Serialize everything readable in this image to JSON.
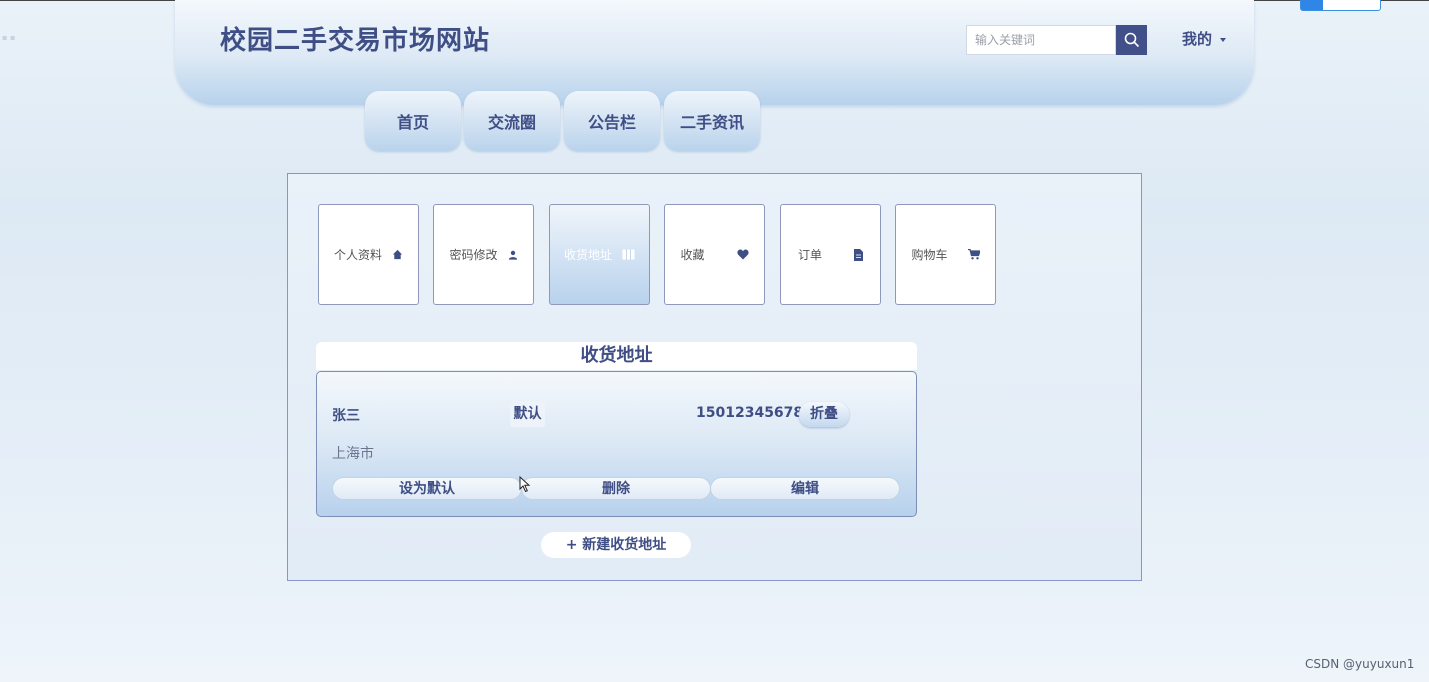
{
  "header": {
    "site_title": "校园二手交易市场网站",
    "search_placeholder": "输入关键词",
    "my_menu_label": "我的"
  },
  "nav": {
    "tabs": [
      {
        "label": "首页"
      },
      {
        "label": "交流圈"
      },
      {
        "label": "公告栏"
      },
      {
        "label": "二手资讯"
      }
    ]
  },
  "sidebar_cards": [
    {
      "label": "个人资料",
      "icon": "home-icon"
    },
    {
      "label": "密码修改",
      "icon": "user-icon"
    },
    {
      "label": "收货地址",
      "icon": "address-icon",
      "active": true
    },
    {
      "label": "收藏",
      "icon": "heart-icon"
    },
    {
      "label": "订单",
      "icon": "document-icon"
    },
    {
      "label": "购物车",
      "icon": "cart-icon"
    }
  ],
  "address_section": {
    "title": "收货地址",
    "entry": {
      "name": "张三",
      "default_badge": "默认",
      "phone": "15012345678",
      "fold_label": "折叠",
      "city": "上海市"
    },
    "actions": {
      "set_default": "设为默认",
      "delete": "删除",
      "edit": "编辑"
    },
    "new_address_label": "+ 新建收货地址"
  },
  "watermark": "CSDN @yuyuxun1",
  "colors": {
    "accent": "#3f4f86",
    "search_button": "#415089",
    "panel_border": "#8796c4"
  }
}
